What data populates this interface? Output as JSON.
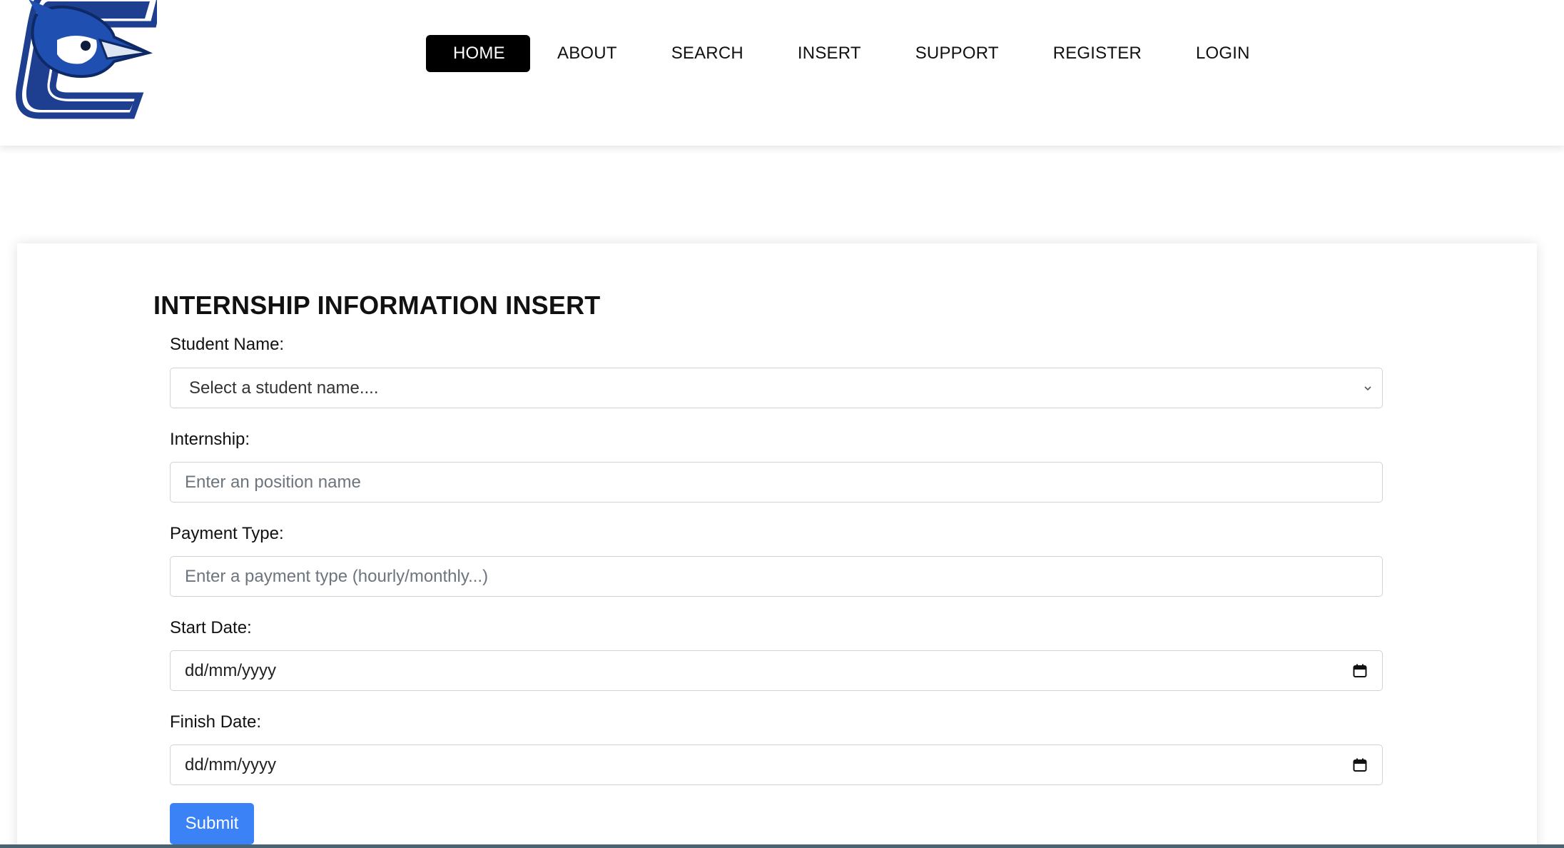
{
  "nav": {
    "items": [
      {
        "label": "HOME",
        "active": true
      },
      {
        "label": "ABOUT"
      },
      {
        "label": "SEARCH"
      },
      {
        "label": "INSERT"
      },
      {
        "label": "SUPPORT"
      },
      {
        "label": "REGISTER"
      },
      {
        "label": "LOGIN"
      }
    ]
  },
  "form": {
    "title": "INTERNSHIP INFORMATION INSERT",
    "student": {
      "label": "Student Name:",
      "selected": "Select a student name...."
    },
    "internship": {
      "label": "Internship:",
      "placeholder": "Enter an position name"
    },
    "payment": {
      "label": "Payment Type:",
      "placeholder": "Enter a payment type (hourly/monthly...)"
    },
    "start_date": {
      "label": "Start Date:",
      "placeholder": "dd/mm/yyyy"
    },
    "finish_date": {
      "label": "Finish Date:",
      "placeholder": "dd/mm/yyyy"
    },
    "submit_label": "Submit"
  },
  "colors": {
    "nav_active_bg": "#000000",
    "submit_bg": "#3b82f6",
    "logo_blue": "#1e3f8f",
    "bottom_bar": "#4a6373"
  },
  "icons": {
    "logo": "bluejay-logo-icon",
    "select_arrow": "chevron-down-icon",
    "date_picker": "calendar-icon"
  }
}
